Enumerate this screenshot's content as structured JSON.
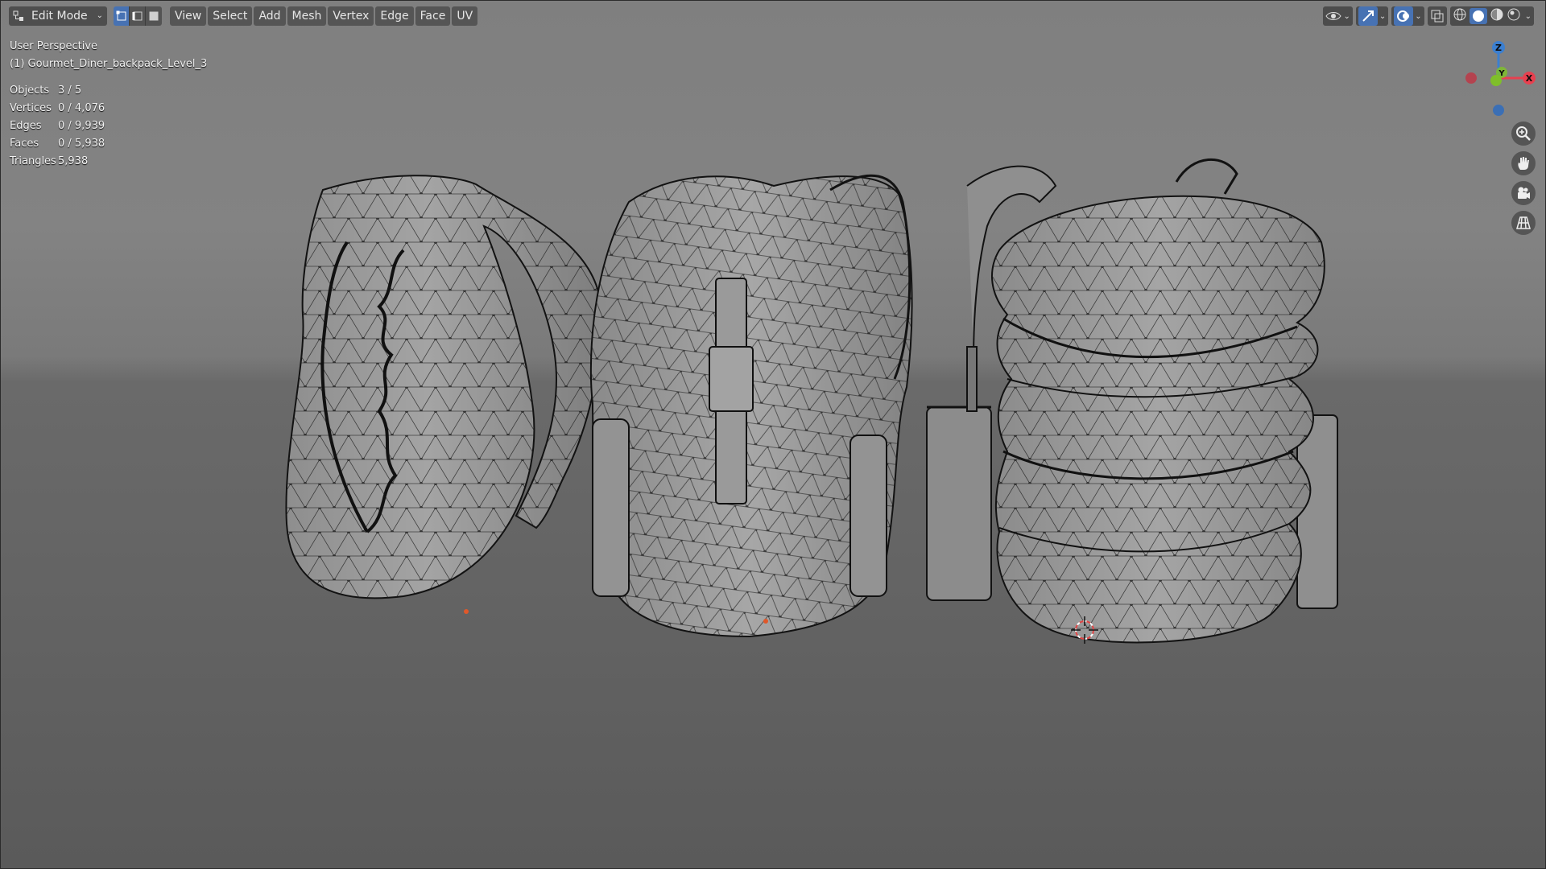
{
  "header": {
    "mode": "Edit Mode",
    "menus": [
      "View",
      "Select",
      "Add",
      "Mesh",
      "Vertex",
      "Edge",
      "Face",
      "UV"
    ]
  },
  "select_modes": [
    "vertex-select-icon",
    "edge-select-icon",
    "face-select-icon"
  ],
  "header_right_icons": [
    "visibility-icon",
    "gizmo-icon",
    "overlay-icon",
    "xray-icon",
    "wireframe-shading-icon",
    "solid-shading-icon",
    "material-shading-icon",
    "rendered-shading-icon"
  ],
  "overlay": {
    "view_name": "User Perspective",
    "object_name": "(1) Gourmet_Diner_backpack_Level_3"
  },
  "stats": {
    "rows": [
      {
        "label": "Objects",
        "value": "3 / 5"
      },
      {
        "label": "Vertices",
        "value": "0 / 4,076"
      },
      {
        "label": "Edges",
        "value": "0 / 9,939"
      },
      {
        "label": "Faces",
        "value": "0 / 5,938"
      },
      {
        "label": "Triangles",
        "value": "5,938"
      }
    ]
  },
  "gizmo": {
    "x_label": "X",
    "y_label": "Y",
    "z_label": "Z"
  },
  "colors": {
    "x_axis": "#e8404f",
    "y_axis": "#7fbf2a",
    "z_axis": "#3b7fd0",
    "accent": "#4772b3",
    "wire": "#121212",
    "mesh": "#9c9c9c"
  },
  "nav_icons": [
    "zoom-icon",
    "pan-hand-icon",
    "camera-icon",
    "grid-perspective-icon"
  ]
}
